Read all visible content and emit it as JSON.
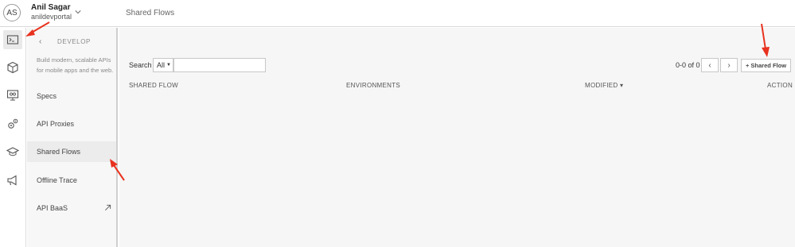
{
  "header": {
    "avatar_initials": "AS",
    "user_name": "Anil Sagar",
    "org_name": "anildevportal",
    "page_title": "Shared Flows"
  },
  "icon_rail": [
    {
      "icon": "terminal-icon",
      "active": true
    },
    {
      "icon": "box-icon",
      "active": false
    },
    {
      "icon": "monitor-icon",
      "active": false
    },
    {
      "icon": "gears-icon",
      "active": false
    },
    {
      "icon": "graduation-cap-icon",
      "active": false
    },
    {
      "icon": "megaphone-icon",
      "active": false
    }
  ],
  "subnav": {
    "back_glyph": "‹",
    "section_title": "DEVELOP",
    "description": "Build modern, scalable APIs for mobile apps and the web.",
    "items": [
      {
        "label": "Specs",
        "selected": false
      },
      {
        "label": "API Proxies",
        "selected": false
      },
      {
        "label": "Shared Flows",
        "selected": true
      },
      {
        "label": "Offline Trace",
        "selected": false
      },
      {
        "label": "API BaaS",
        "selected": false,
        "external": true
      }
    ]
  },
  "toolbar": {
    "search_label": "Search",
    "scope_value": "All",
    "search_value": "",
    "pager_text": "0-0 of 0",
    "prev_glyph": "‹",
    "next_glyph": "›",
    "add_label": "+ Shared Flow"
  },
  "table": {
    "columns": [
      "SHARED FLOW",
      "ENVIRONMENTS",
      "MODIFIED ▾",
      "ACTION"
    ]
  },
  "colors": {
    "annotation_arrow": "#e8321f",
    "content_bg": "#f6f6f6",
    "subnav_bg": "#f7f7f7"
  }
}
